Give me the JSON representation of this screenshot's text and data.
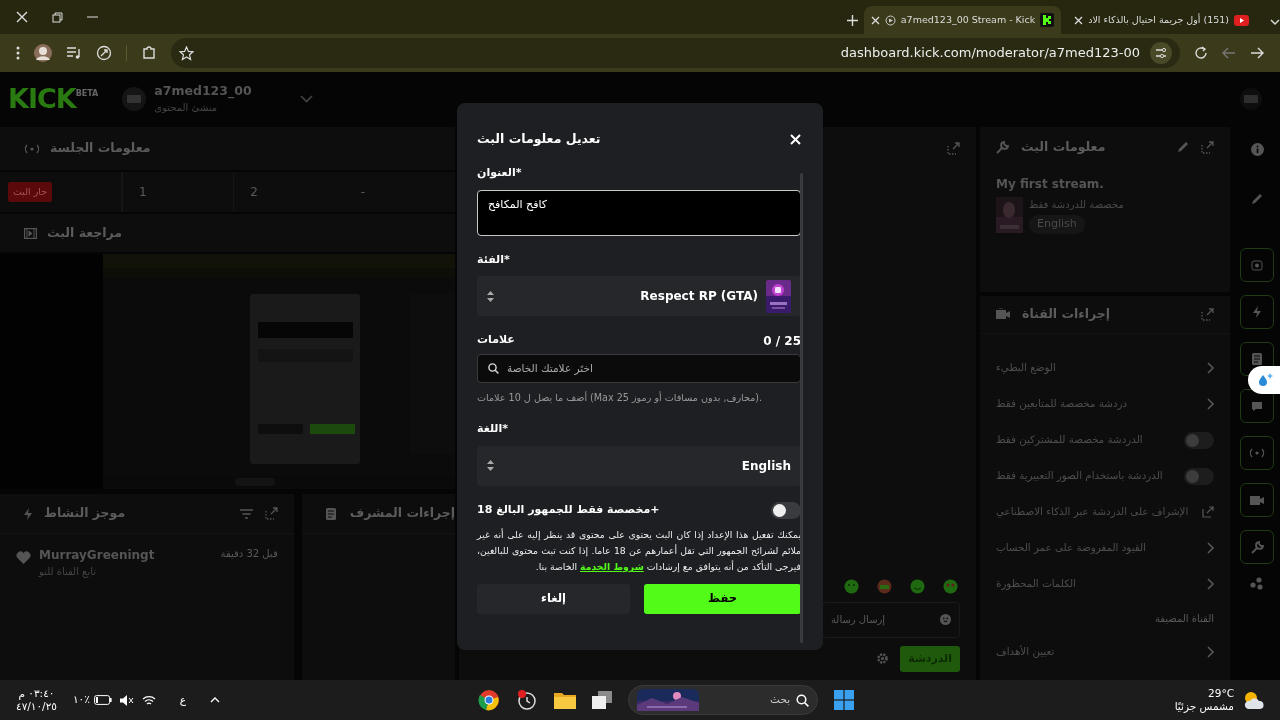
{
  "browser": {
    "tabs": [
      {
        "title": "(151) أول جريمة احتيال بالذكاء الاد",
        "selected": false
      },
      {
        "title": "a7med123_00 Stream - Kick",
        "selected": true
      }
    ],
    "url": "dashboard.kick.com/moderator/a7med123-00"
  },
  "header": {
    "logo": "KICK",
    "logo_badge": "BETA",
    "channel": "a7med123_00",
    "role": "منشئ المحتوى"
  },
  "session": {
    "title": "معلومات الجلسة",
    "status": "جار البث",
    "stats": [
      "-",
      "2",
      "1"
    ]
  },
  "review": {
    "title": "مراجعة البث"
  },
  "activity": {
    "title": "موجز النشاط",
    "items": [
      {
        "user": "MurrayGreeningt",
        "action": "تابع القناة للتو",
        "time": "قبل 32 دقيقة"
      }
    ]
  },
  "mod_actions": {
    "title": "إجراءات المشرف"
  },
  "chat": {
    "placeholder": "إرسال رسالة",
    "send": "الدردشة"
  },
  "stream_info": {
    "title": "معلومات البث",
    "stream_title": "My first stream.",
    "chat_mode": "مخصصة للدردشة فقط",
    "language": "English"
  },
  "channel_actions": {
    "title": "إجراءات القناة",
    "items": [
      {
        "kind": "link",
        "label": "الوضع البطيء"
      },
      {
        "kind": "link",
        "label": "دردشة مخصصة للمتابعين فقط"
      },
      {
        "kind": "toggle",
        "label": "الدردشة مخصصة للمشتركين فقط",
        "on": false
      },
      {
        "kind": "toggle",
        "label": "الدردشة باستخدام الصور التعبيرية فقط",
        "on": false
      },
      {
        "kind": "external",
        "label": "الإشراف على الدردشة عبر الذكاء الاصطناعي"
      },
      {
        "kind": "link",
        "label": "القيود المفروضة على عمر الحساب"
      },
      {
        "kind": "link",
        "label": "الكلمات المحظورة"
      },
      {
        "kind": "heading",
        "label": "القناة المضيفة"
      },
      {
        "kind": "link",
        "label": "تعيين الأهداف"
      }
    ]
  },
  "modal": {
    "title": "تعديل معلومات البث",
    "title_field": {
      "label": "العنوان*",
      "value": "كافح المكافح"
    },
    "category_field": {
      "label": "الفئة*",
      "value": "Respect RP (GTA)"
    },
    "tags_field": {
      "label": "علامات",
      "count": "0 / 25",
      "placeholder": "اختَر علامتك الخاصة",
      "hint": "أضف ما يصل ل 10 علامات (Max 25 محارف, بدون مسافات أو رموز)."
    },
    "language_field": {
      "label": "اللغة*",
      "value": "English"
    },
    "adult_toggle": {
      "label": "مخصصة فقط للجمهور البالغ 18+",
      "on": false
    },
    "description": {
      "before": "يمكنك تفعيل هذا الإعداد إذا كان البث يحتوي على محتوى قد ينظر إليه على أنه غير ملائم لشرائح الجمهور التي تقل أعمارهم عن 18 عاما. إذا كنت تبث محتوى للبالغين، فيرجى التأكد من أنه يتوافق مع إرشادات",
      "link": "شروط الخدمة",
      "after": "الخاصة بنا."
    },
    "cancel": "إلغاء",
    "save": "حفظ"
  },
  "taskbar": {
    "time": "٠٣:٤٠ م",
    "date": "٤٧/١٠/٢٥",
    "battery": "١٠٪",
    "input_language": "ع",
    "search_placeholder": "بحث",
    "temperature": "29°C",
    "weather": "مشمس جزئيًا"
  }
}
